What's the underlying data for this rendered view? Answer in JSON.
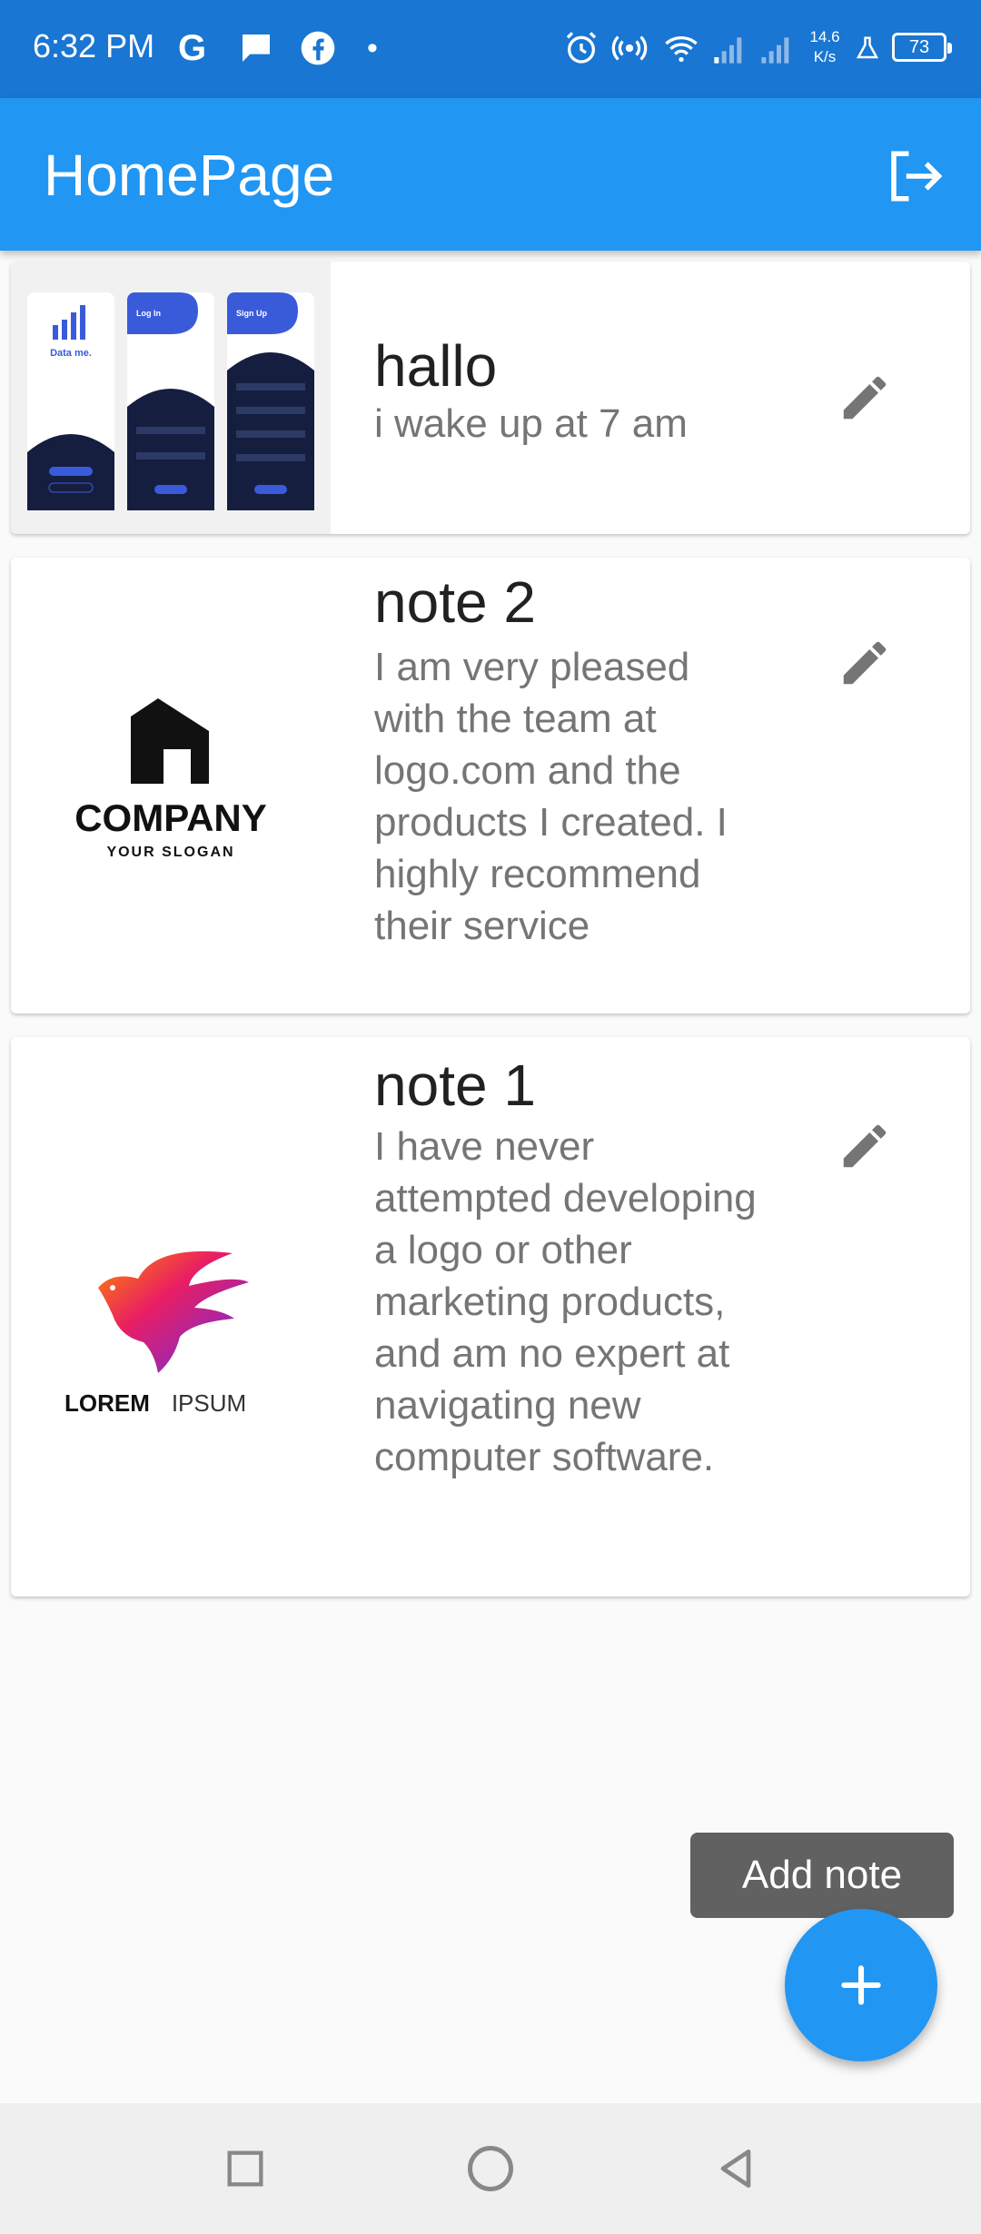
{
  "status_bar": {
    "time": "6:32 PM",
    "speed_value": "14.6",
    "speed_unit": "K/s",
    "battery": "73",
    "icons": [
      "google-icon",
      "message-icon",
      "facebook-icon",
      "dot-icon",
      "alarm-icon",
      "hotspot-icon",
      "wifi-icon",
      "signal-icon",
      "lab-icon",
      "battery-icon"
    ]
  },
  "app_bar": {
    "title": "HomePage",
    "action_icon": "logout-icon"
  },
  "notes": [
    {
      "title": "hallo",
      "body": "i wake up at 7 am",
      "thumb_icon": "app-screens-thumbnail"
    },
    {
      "title": "note 2",
      "body": "I am very pleased with the team at logo.com and the products I created. I highly recommend their service",
      "thumb_icon": "company-logo"
    },
    {
      "title": "note 1",
      "body": "I have never attempted developing a logo or other marketing products, and am no expert at navigating new computer software.",
      "thumb_icon": "bird-logo"
    }
  ],
  "logos": {
    "company_name": "COMPANY",
    "company_slogan": "YOUR SLOGAN",
    "lorem_bold": "LOREM",
    "lorem_light": "IPSUM"
  },
  "mock_screens": {
    "screen1_title": "Data me.",
    "screen2_title": "Log In",
    "screen3_title": "Sign Up"
  },
  "fab": {
    "tooltip": "Add note",
    "icon": "plus-icon"
  },
  "nav_bar": {
    "icons": [
      "recents-icon",
      "home-icon",
      "back-icon"
    ]
  },
  "colors": {
    "primary": "#2196f3",
    "status_bar": "#1976d2",
    "tooltip": "#616161"
  }
}
